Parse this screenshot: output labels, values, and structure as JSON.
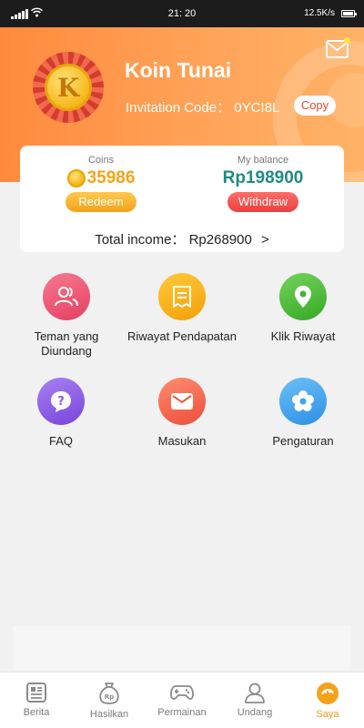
{
  "status_bar": {
    "time": "21: 20",
    "network_speed": "12.5K/s"
  },
  "header": {
    "app_name": "Koin Tunai",
    "logo_letter": "K",
    "invitation_text": "Invitation Code： 0YCI8L",
    "copy_label": "Copy",
    "has_notification": true
  },
  "card": {
    "coins_label": "Coins",
    "coins_value": "35986",
    "redeem_label": "Redeem",
    "balance_label": "My balance",
    "balance_value": "Rp198900",
    "withdraw_label": "Withdraw",
    "total_income": "Total income： Rp268900",
    "total_arrow": ">"
  },
  "menu": [
    {
      "label": "Teman yang\nDiundang",
      "icon": "friends-icon",
      "color": "#ee4f6e"
    },
    {
      "label": "Riwayat Pendapatan",
      "icon": "receipt-icon",
      "color": "#f7b20c"
    },
    {
      "label": "Klik Riwayat",
      "icon": "location-pin-icon",
      "color": "#4cbd36"
    },
    {
      "label": "FAQ",
      "icon": "question-icon",
      "color": "#8b58e6"
    },
    {
      "label": "Masukan",
      "icon": "envelope-icon",
      "color": "#f0624c"
    },
    {
      "label": "Pengaturan",
      "icon": "gear-flower-icon",
      "color": "#3fa3f0"
    }
  ],
  "tabs": [
    {
      "label": "Berita",
      "icon": "news-icon"
    },
    {
      "label": "Hasilkan",
      "icon": "money-bag-icon"
    },
    {
      "label": "Permainan",
      "icon": "gamepad-icon"
    },
    {
      "label": "Undang",
      "icon": "invite-user-icon"
    },
    {
      "label": "Saya",
      "icon": "profile-icon"
    }
  ],
  "active_tab": "Saya",
  "colors": {
    "accent": "#ff8a3d",
    "coins": "#f3a418",
    "balance": "#1e8c82",
    "active_tab": "#f29b18"
  }
}
